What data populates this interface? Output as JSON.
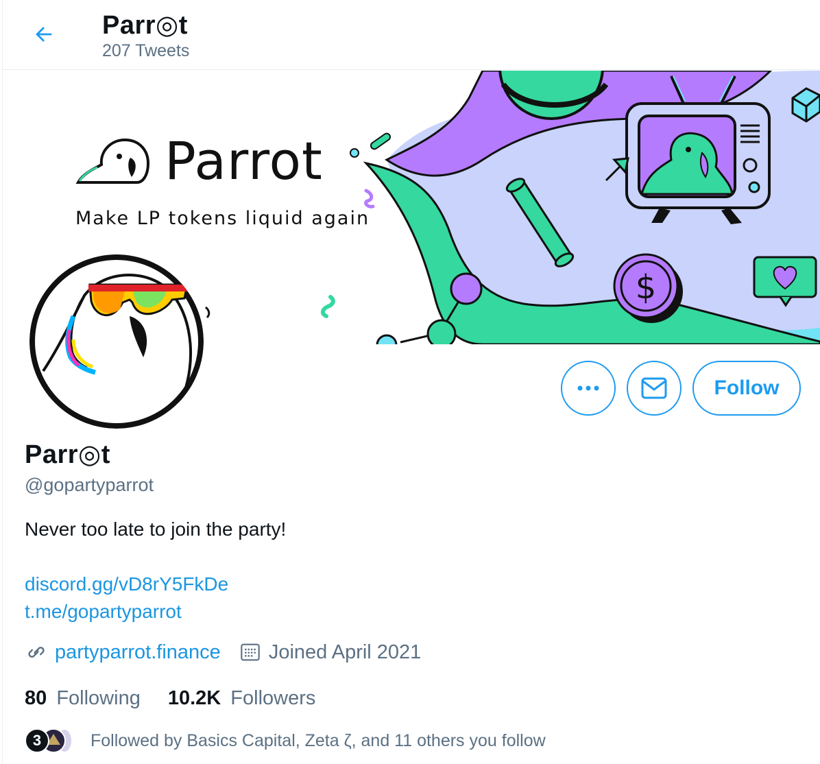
{
  "header": {
    "title": "Parr◎t",
    "tweet_count": "207 Tweets"
  },
  "banner": {
    "brand_name": "Parrot",
    "tagline": "Make LP tokens liquid again",
    "dollar_symbol": "$"
  },
  "actions": {
    "follow_label": "Follow"
  },
  "profile": {
    "name": "Parr◎t",
    "handle": "@gopartyparrot",
    "bio": "Never too late to join the party!",
    "links": [
      "discord.gg/vD8rY5FkDe",
      "t.me/gopartyparrot"
    ],
    "website": "partyparrot.finance",
    "joined": "Joined April 2021"
  },
  "stats": {
    "following_count": "80",
    "following_label": "Following",
    "followers_count": "10.2K",
    "followers_label": "Followers"
  },
  "followed_by": {
    "avatar_initial": "3",
    "text": "Followed by Basics Capital, Zeta ζ, and 11 others you follow"
  },
  "colors": {
    "accent": "#1d9bf0",
    "link": "#1b95e0",
    "muted": "#5b7083",
    "banner_purple": "#b57bff",
    "banner_green": "#35d89f",
    "banner_lavender": "#c9d3fb",
    "banner_cyan": "#72e3f5"
  }
}
